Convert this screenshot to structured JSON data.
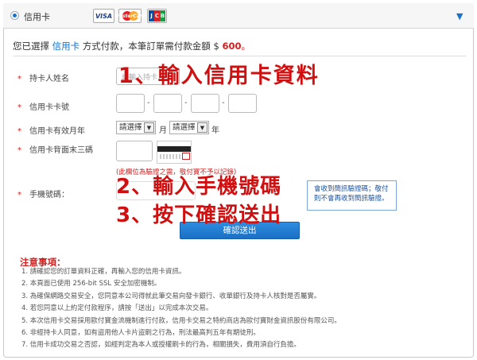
{
  "header": {
    "title": "信用卡",
    "logos": [
      "VISA",
      "MasterCard",
      "JCB"
    ],
    "dropdown_icon": "triangle-down"
  },
  "summary": {
    "prefix": "您已選擇",
    "method": "信用卡",
    "middle": "方式付款，本筆訂單需付款金額 $",
    "amount": "600",
    "suffix": "。"
  },
  "form": {
    "star": "*",
    "holder_label": "持卡人姓名",
    "holder_placeholder": "請輸入持卡人",
    "card_number_label": "信用卡卡號",
    "card_dash": "-",
    "expiry_label": "信用卡有效月年",
    "expiry_month_value": "請選擇",
    "expiry_month_unit": "月",
    "expiry_year_value": "請選擇",
    "expiry_year_unit": "年",
    "cvv_label": "信用卡背面末三碼",
    "cvv_note": "(此欄位為驗證之需，敬付寶不予以記錄)",
    "phone_label": "手機號碼：",
    "sms_line1": "會收到簡訊驗證碼；敬付",
    "sms_line2": "則不會再收到簡訊驗證。",
    "confirm_label": "確認送出"
  },
  "annotations": {
    "step1": "1、輸入信用卡資料",
    "step2": "2、輸入手機號碼",
    "step3": "3、按下確認送出"
  },
  "notice": {
    "title": "注意事項：",
    "items": [
      "1.  請確認您的訂單資料正確，再輸入您的信用卡資訊。",
      "2.  本頁面已使用 256-bit SSL 安全加密機制。",
      "3.  為確保網路交易安全，您同意本公司得就此筆交易向發卡銀行、收單銀行及持卡人核對是否屬實。",
      "4.  若您同意以上約定付款程序，請按「送出」以完成本次交易。",
      "5.  本次信用卡交易採用歐付寶金流機制進行付款，信用卡交易之特約商店為歐付寶財金資訊股份有限公司。",
      "6.  非經持卡人同意，如有盜用他人卡片盜刷之行為，刑法最高判五年有期徒刑。",
      "7.  信用卡成功交易之否認，如經判定為本人或授權刷卡的行為，相關損失，費用須自行負擔。"
    ]
  }
}
